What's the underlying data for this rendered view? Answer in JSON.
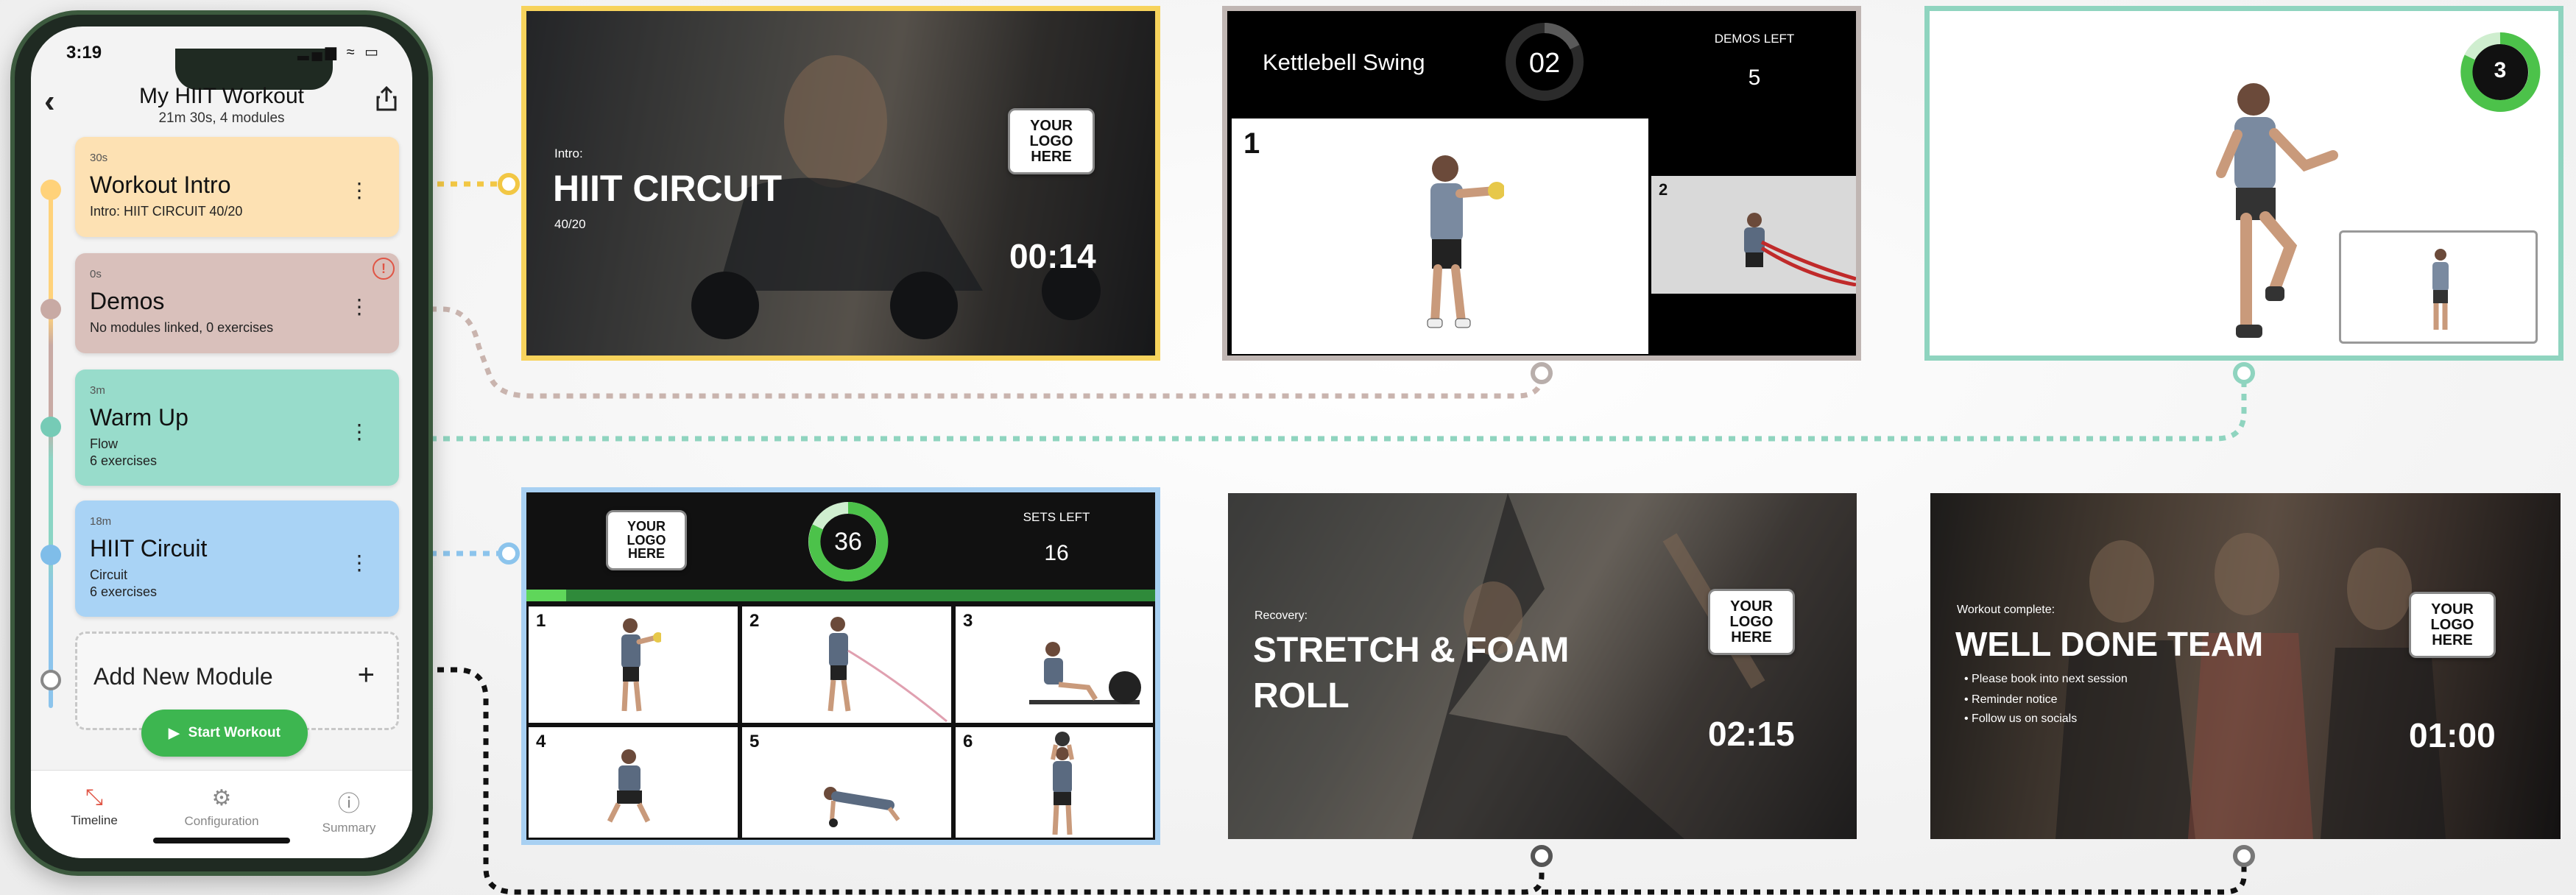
{
  "phone": {
    "status_time": "3:19",
    "status_icons": "▂▄▆ ≈ ▭",
    "header": {
      "title": "My HIIT Workout",
      "subtitle": "21m 30s, 4 modules"
    },
    "modules": [
      {
        "duration": "30s",
        "name": "Workout Intro",
        "description": "Intro: HIIT CIRCUIT 40/20",
        "color": "#fde1b3",
        "dot": "#ffd27a"
      },
      {
        "duration": "0s",
        "name": "Demos",
        "description": "No modules linked, 0 exercises",
        "color": "#d9c0bb",
        "dot": "#c8aaa4"
      },
      {
        "duration": "3m",
        "name": "Warm Up",
        "description": "Flow",
        "description2": "6 exercises",
        "color": "#98dccb",
        "dot": "#76cbb6"
      },
      {
        "duration": "18m",
        "name": "HIIT Circuit",
        "description": "Circuit",
        "description2": "6 exercises",
        "color": "#a9d3f5",
        "dot": "#7fbde9"
      }
    ],
    "add_module_label": "Add New Module",
    "add_icon": "+",
    "start_button": "Start Workout",
    "alert_icon": "!",
    "tabs": [
      {
        "label": "Timeline",
        "icon": "timeline-icon",
        "active": true
      },
      {
        "label": "Configuration",
        "icon": "gear-icon",
        "active": false
      },
      {
        "label": "Summary",
        "icon": "info-icon",
        "active": false
      }
    ]
  },
  "previews": {
    "intro": {
      "prefix": "Intro:",
      "title": "HIIT CIRCUIT",
      "subtitle": "40/20",
      "logo": "YOUR LOGO HERE",
      "timer": "00:14",
      "border_color": "#f7d35c"
    },
    "demo": {
      "exercise": "Kettlebell Swing",
      "countdown": "02",
      "demos_left_label": "DEMOS LEFT",
      "demos_left": "5",
      "main_num": "1",
      "next_num": "2",
      "border_color": "#c0b6b3"
    },
    "warmup": {
      "countdown": "3",
      "border_color": "#8fd4bf"
    },
    "circuit": {
      "logo": "YOUR LOGO HERE",
      "countdown": "36",
      "sets_left_label": "SETS LEFT",
      "sets_left": "16",
      "cells": [
        "1",
        "2",
        "3",
        "4",
        "5",
        "6"
      ],
      "border_color": "#a8d0f2"
    },
    "recovery": {
      "prefix": "Recovery:",
      "title_line1": "STRETCH & FOAM",
      "title_line2": "ROLL",
      "logo": "YOUR LOGO HERE",
      "timer": "02:15"
    },
    "complete": {
      "prefix": "Workout complete:",
      "title": "WELL DONE TEAM",
      "bullets": [
        "Please book into next session",
        "Reminder notice",
        "Follow us on socials"
      ],
      "logo": "YOUR LOGO HERE",
      "timer": "01:00"
    }
  }
}
